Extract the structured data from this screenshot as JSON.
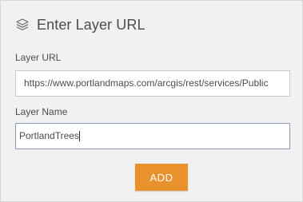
{
  "dialog": {
    "title": "Enter Layer URL",
    "title_icon": "layers-icon"
  },
  "fields": {
    "layer_url": {
      "label": "Layer URL",
      "value": "https://www.portlandmaps.com/arcgis/rest/services/Public"
    },
    "layer_name": {
      "label": "Layer Name",
      "value": "PortlandTrees"
    }
  },
  "actions": {
    "add_label": "ADD"
  },
  "colors": {
    "accent": "#e8912d",
    "panel_bg": "#f1f1f1",
    "text": "#4c4c4c"
  }
}
